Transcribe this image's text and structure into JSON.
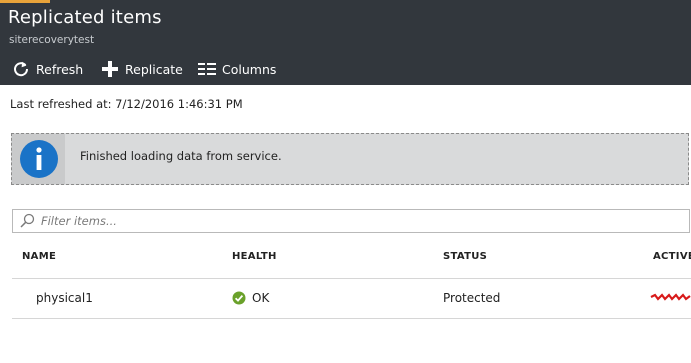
{
  "header": {
    "title": "Replicated items",
    "subtitle": "siterecoverytest"
  },
  "toolbar": {
    "refresh_label": "Refresh",
    "replicate_label": "Replicate",
    "columns_label": "Columns"
  },
  "last_refreshed": "Last refreshed at: 7/12/2016 1:46:31 PM",
  "info_banner": {
    "icon": "info-icon",
    "message": "Finished loading data from service."
  },
  "filter": {
    "placeholder": "Filter items...",
    "value": ""
  },
  "table": {
    "columns": [
      "NAME",
      "HEALTH",
      "STATUS",
      "ACTIVE"
    ],
    "rows": [
      {
        "name": "physical1",
        "health": "OK",
        "status": "Protected",
        "active": ""
      }
    ]
  },
  "colors": {
    "header_bg": "#32373d",
    "accent": "#e8a33a",
    "info_blue": "#1a73c7",
    "ok_green": "#6aa12a",
    "redaction_red": "#d81a1a"
  }
}
